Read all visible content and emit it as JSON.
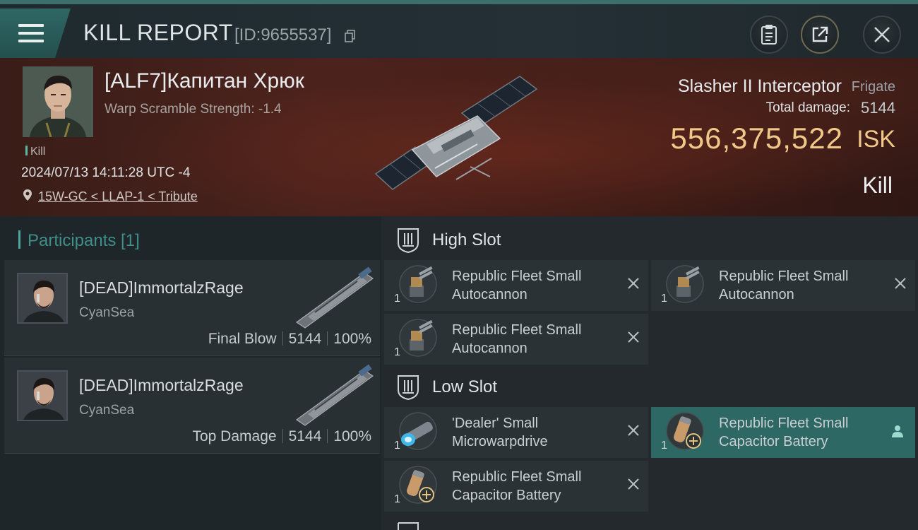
{
  "header": {
    "title": "KILL REPORT",
    "report_id": "[ID:9655537]",
    "icons": [
      "menu-icon",
      "copy-icon",
      "clipboard-icon",
      "share-icon",
      "close-icon"
    ]
  },
  "victim": {
    "name": "[ALF7]Капитан Хрюк",
    "subtitle": "Warp Scramble Strength: -1.4",
    "tag": "Kill",
    "timestamp": "2024/07/13 14:11:28 UTC -4",
    "location": "15W-GC < LLAP-1 < Tribute"
  },
  "ship": {
    "name": "Slasher II Interceptor",
    "class": "Frigate",
    "total_damage_label": "Total damage:",
    "total_damage": "5144",
    "isk_value": "556,375,522",
    "isk_unit": "ISK",
    "result": "Kill"
  },
  "participants": {
    "heading": "Participants [1]",
    "rows": [
      {
        "name": "[DEAD]ImmortalzRage",
        "corp": "CyanSea",
        "role": "Final Blow",
        "damage": "5144",
        "percent": "100%"
      },
      {
        "name": "[DEAD]ImmortalzRage",
        "corp": "CyanSea",
        "role": "Top Damage",
        "damage": "5144",
        "percent": "100%"
      }
    ]
  },
  "fittings": {
    "high_slot": {
      "title": "High Slot",
      "modules": [
        {
          "line1": "Republic Fleet Small",
          "line2": "Autocannon",
          "qty": "1",
          "state": "destroyed"
        },
        {
          "line1": "Republic Fleet Small",
          "line2": "Autocannon",
          "qty": "1",
          "state": "destroyed"
        },
        {
          "line1": "Republic Fleet Small",
          "line2": "Autocannon",
          "qty": "1",
          "state": "destroyed"
        }
      ]
    },
    "low_slot": {
      "title": "Low Slot",
      "modules": [
        {
          "line1": "'Dealer' Small",
          "line2": "Microwarpdrive",
          "qty": "1",
          "state": "destroyed"
        },
        {
          "line1": "Republic Fleet Small",
          "line2": "Capacitor Battery",
          "qty": "1",
          "state": "dropped"
        },
        {
          "line1": "Republic Fleet Small",
          "line2": "Capacitor Battery",
          "qty": "1",
          "state": "destroyed"
        }
      ]
    }
  },
  "colors": {
    "accent_teal": "#2d6864",
    "isk_gold": "#f0c98a",
    "banner_red": "#4a221c"
  }
}
